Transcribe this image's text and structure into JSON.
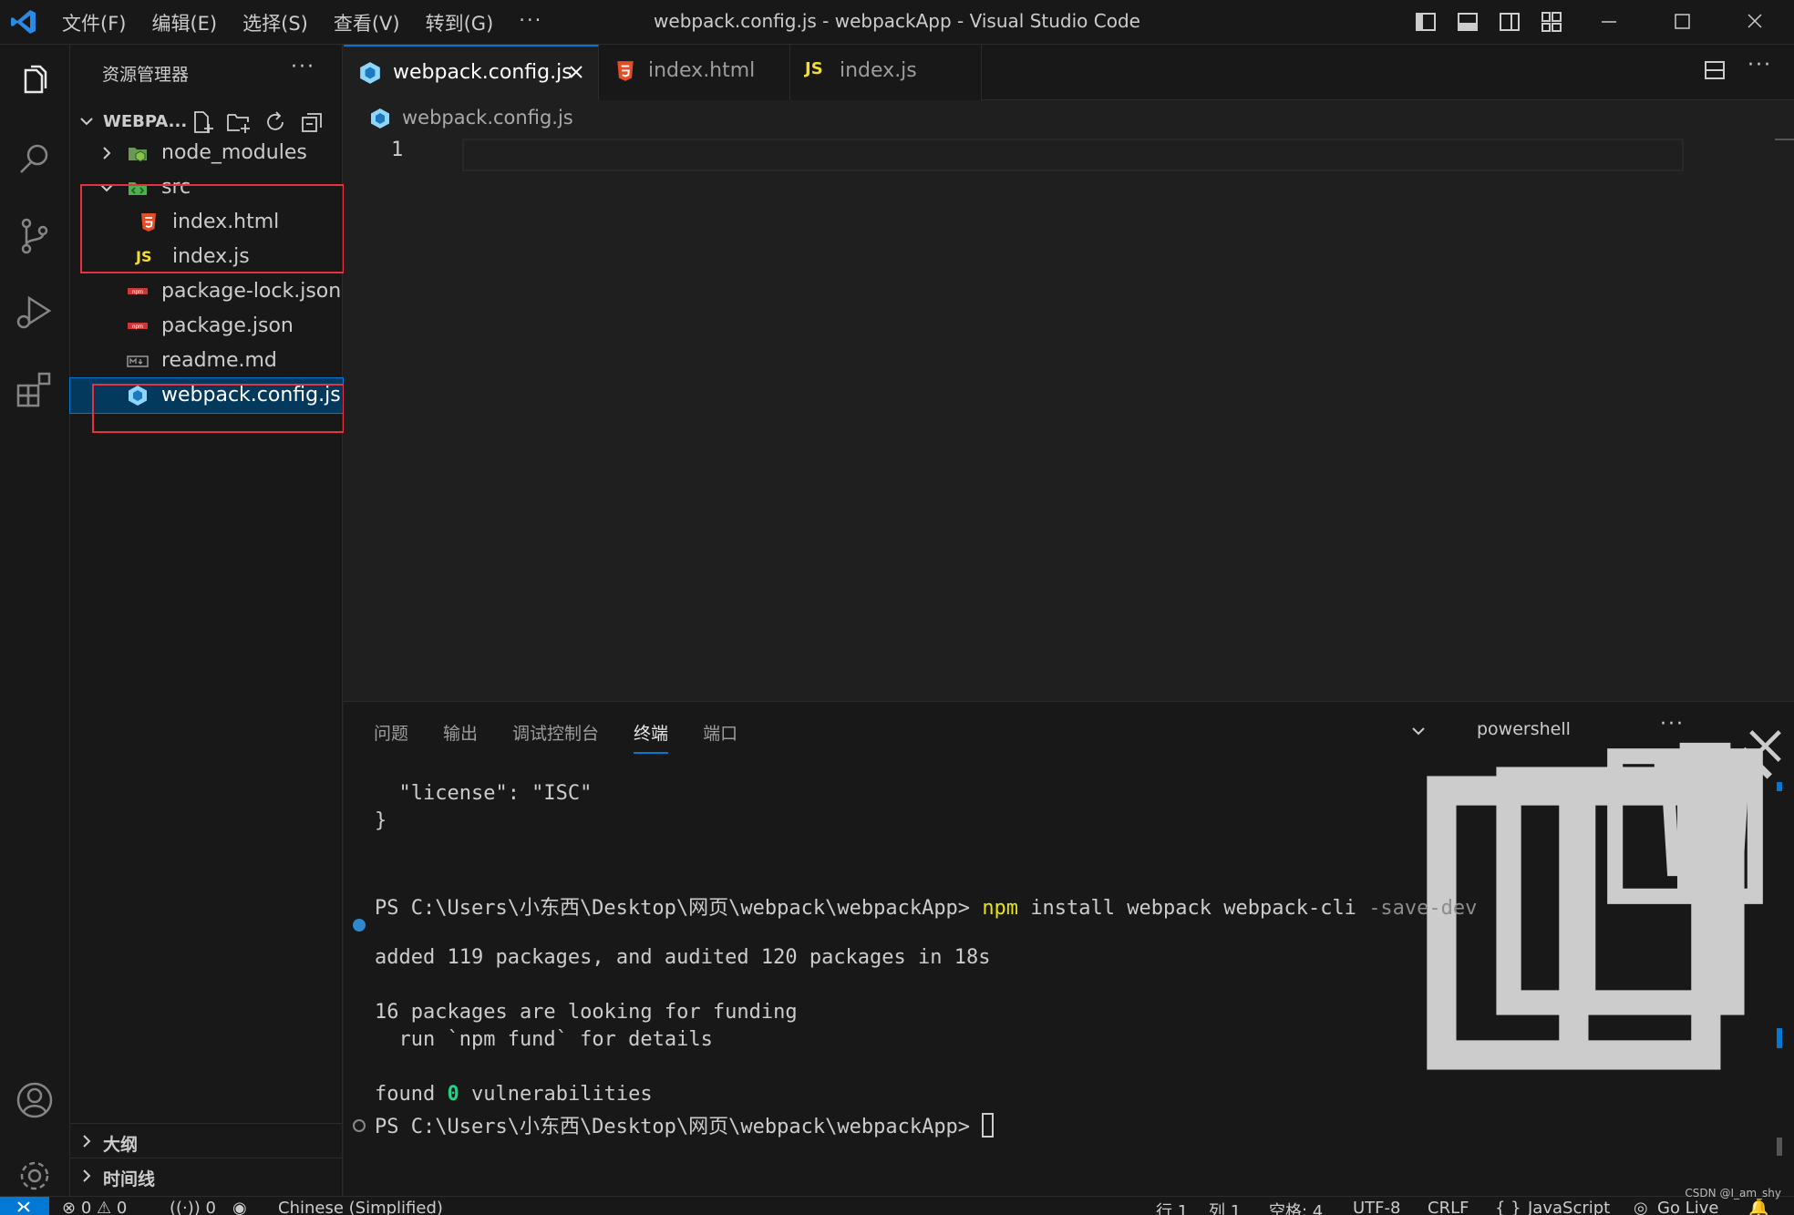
{
  "window": {
    "title": "webpack.config.js - webpackApp - Visual Studio Code",
    "menu": [
      "文件(F)",
      "编辑(E)",
      "选择(S)",
      "查看(V)",
      "转到(G)"
    ],
    "menu_more": "···"
  },
  "sidebar": {
    "header": "资源管理器",
    "more": "···",
    "root_label": "WEBPA...",
    "items": [
      {
        "label": "node_modules",
        "icon": "folder-node-icon",
        "kind": "folder-collapsed"
      },
      {
        "label": "src",
        "icon": "folder-src-icon",
        "kind": "folder-expanded"
      },
      {
        "label": "index.html",
        "icon": "html5-icon",
        "kind": "file"
      },
      {
        "label": "index.js",
        "icon": "js-icon",
        "kind": "file"
      },
      {
        "label": "package-lock.json",
        "icon": "npm-icon",
        "kind": "file"
      },
      {
        "label": "package.json",
        "icon": "npm-icon",
        "kind": "file"
      },
      {
        "label": "readme.md",
        "icon": "markdown-icon",
        "kind": "file"
      },
      {
        "label": "webpack.config.js",
        "icon": "webpack-icon",
        "kind": "file",
        "selected": true
      }
    ],
    "sections": [
      {
        "label": "大纲"
      },
      {
        "label": "时间线"
      }
    ]
  },
  "tabs": [
    {
      "label": "webpack.config.js",
      "icon": "webpack-icon",
      "active": true
    },
    {
      "label": "index.html",
      "icon": "html5-icon",
      "active": false
    },
    {
      "label": "index.js",
      "icon": "js-icon",
      "active": false
    }
  ],
  "breadcrumb": {
    "file": "webpack.config.js"
  },
  "editor": {
    "line_number": "1"
  },
  "panel": {
    "tabs": [
      "问题",
      "输出",
      "调试控制台",
      "终端",
      "端口"
    ],
    "active_tab": "终端",
    "shell": "powershell",
    "terminal": {
      "line1": "  \"license\": \"ISC\"",
      "line2": "}",
      "prompt": "PS C:\\Users\\小东西\\Desktop\\网页\\webpack\\webpackApp>",
      "cmd": "npm",
      "args": "install webpack webpack-cli",
      "flag": "-save-dev",
      "out1": "added 119 packages, and audited 120 packages in 18s",
      "out2": "16 packages are looking for funding",
      "out3": "  run `npm fund` for details",
      "found_pre": "found ",
      "found_zero": "0",
      "found_post": " vulnerabilities"
    }
  },
  "statusbar": {
    "errors": "0",
    "warnings": "0",
    "ports": "0",
    "language_pack": "Chinese (Simplified)",
    "position_line": "行 1",
    "position_col": "列 1",
    "spaces": "空格: 4",
    "encoding": "UTF-8",
    "eol": "CRLF",
    "language_braces": "{ }",
    "language": "JavaScript",
    "golive": "Go Live"
  },
  "watermark": "CSDN @I_am_shy",
  "colors": {
    "accent": "#0078d4",
    "annotation_red": "#e5323e",
    "terminal_cmd": "#e5e510",
    "terminal_zero": "#23d18b"
  }
}
